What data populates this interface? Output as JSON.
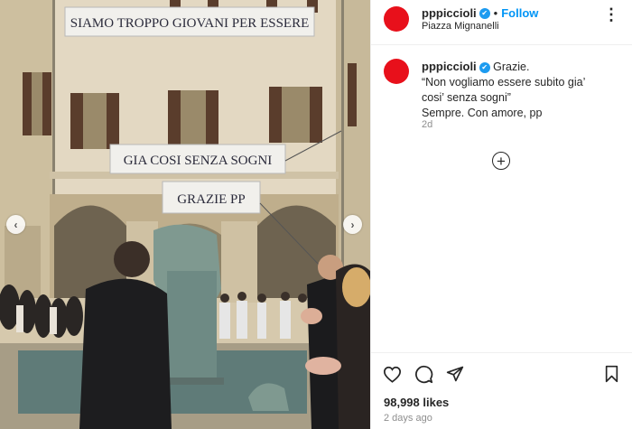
{
  "post": {
    "username": "pppiccioli",
    "verified_mark": "✔",
    "separator": "•",
    "follow_label": "Follow",
    "location": "Piazza Mignanelli",
    "more_glyph": "⋮",
    "caption_lines": [
      "Grazie.",
      "“Non vogliamo essere subito gia’",
      "cosi’ senza sogni”",
      "Sempre. Con amore, pp"
    ],
    "caption_age": "2d",
    "add_comment_glyph": "+",
    "likes": "98,998 likes",
    "posted_ago": "2 days ago"
  },
  "photo": {
    "banners": [
      "SIAMO TROPPO GIOVANI PER ESSERE",
      "GIA COSI SENZA SOGNI",
      "GRAZIE PP"
    ],
    "prev_glyph": "‹",
    "next_glyph": "›"
  },
  "icons": {
    "avatar": "red-circle-avatar",
    "like": "heart-icon",
    "comment": "comment-bubble-icon",
    "share": "paper-plane-icon",
    "save": "bookmark-icon"
  },
  "colors": {
    "avatar": "#e8101b",
    "follow": "#0095f6",
    "verified": "#1d9bf0",
    "muted": "#8e8e8e"
  }
}
